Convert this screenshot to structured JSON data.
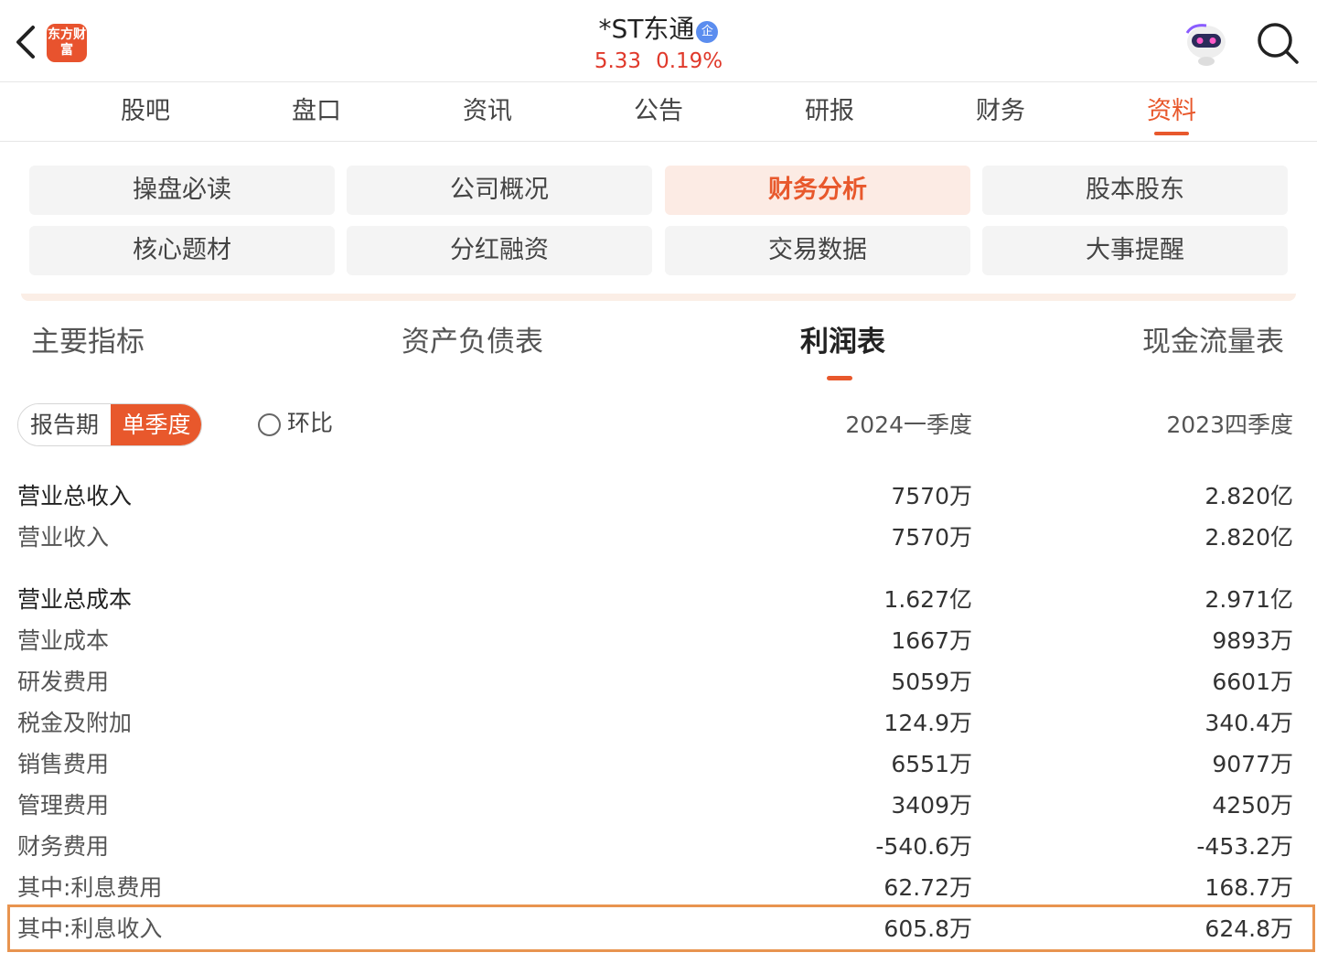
{
  "header": {
    "logo_text": "东方财富",
    "stock_name": "*ST东通",
    "badge": "企",
    "price": "5.33",
    "change": "0.19%",
    "accent_color": "#e8582c",
    "price_color": "#e0392b"
  },
  "tabs": [
    "股吧",
    "盘口",
    "资讯",
    "公告",
    "研报",
    "财务",
    "资料"
  ],
  "active_tab": "资料",
  "grid": [
    "操盘必读",
    "公司概况",
    "财务分析",
    "股本股东",
    "核心题材",
    "分红融资",
    "交易数据",
    "大事提醒"
  ],
  "active_grid": "财务分析",
  "subtabs": [
    "主要指标",
    "资产负债表",
    "利润表",
    "现金流量表"
  ],
  "active_subtab": "利润表",
  "period_toggle": {
    "option1": "报告期",
    "option2": "单季度",
    "selected": "单季度"
  },
  "radio_label": "环比",
  "columns": [
    "2024一季度",
    "2023四季度"
  ],
  "rows": [
    {
      "name": "营业总收入",
      "v1": "7570万",
      "v2": "2.820亿"
    },
    {
      "name": "营业收入",
      "v1": "7570万",
      "v2": "2.820亿"
    },
    {
      "name": "营业总成本",
      "v1": "1.627亿",
      "v2": "2.971亿"
    },
    {
      "name": "营业成本",
      "v1": "1667万",
      "v2": "9893万"
    },
    {
      "name": "研发费用",
      "v1": "5059万",
      "v2": "6601万"
    },
    {
      "name": "税金及附加",
      "v1": "124.9万",
      "v2": "340.4万"
    },
    {
      "name": "销售费用",
      "v1": "6551万",
      "v2": "9077万"
    },
    {
      "name": "管理费用",
      "v1": "3409万",
      "v2": "4250万"
    },
    {
      "name": "财务费用",
      "v1": "-540.6万",
      "v2": "-453.2万"
    },
    {
      "name": "其中:利息费用",
      "v1": "62.72万",
      "v2": "168.7万"
    },
    {
      "name": "其中:利息收入",
      "v1": "605.8万",
      "v2": "624.8万"
    }
  ]
}
